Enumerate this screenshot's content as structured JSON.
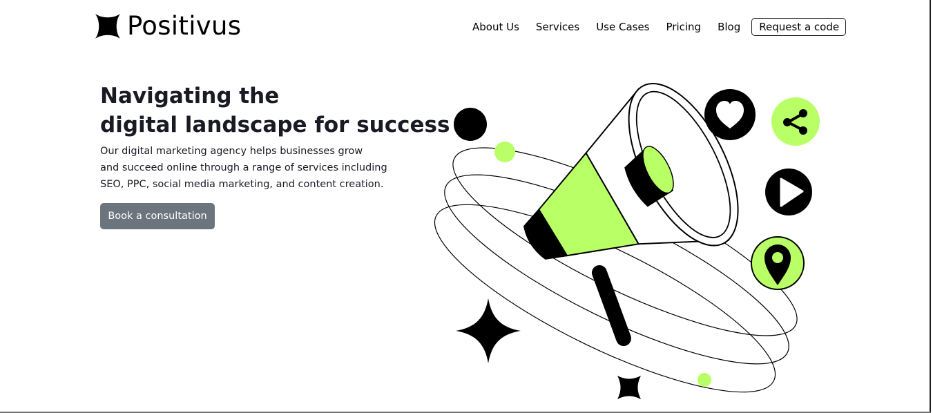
{
  "brand": {
    "name": "Positivus",
    "accent_color": "#B9FF66",
    "dark_color": "#191A23"
  },
  "nav": {
    "items": [
      {
        "label": "About Us"
      },
      {
        "label": "Services"
      },
      {
        "label": "Use Cases"
      },
      {
        "label": "Pricing"
      },
      {
        "label": "Blog"
      }
    ],
    "cta_label": "Request a code"
  },
  "hero": {
    "title_line1": "Navigating the",
    "title_line2": "digital landscape for success",
    "desc_line1": "Our digital marketing agency helps businesses grow",
    "desc_line2": "and succeed online through a range of services including",
    "desc_line3": "SEO, PPC, social media marketing, and content creation.",
    "button_label": "Book a consultation",
    "button_color": "#6C757D"
  },
  "illustration": {
    "icons": [
      "megaphone-icon",
      "heart-icon",
      "share-icon",
      "play-icon",
      "location-pin-icon",
      "sparkle-star-icon"
    ]
  }
}
